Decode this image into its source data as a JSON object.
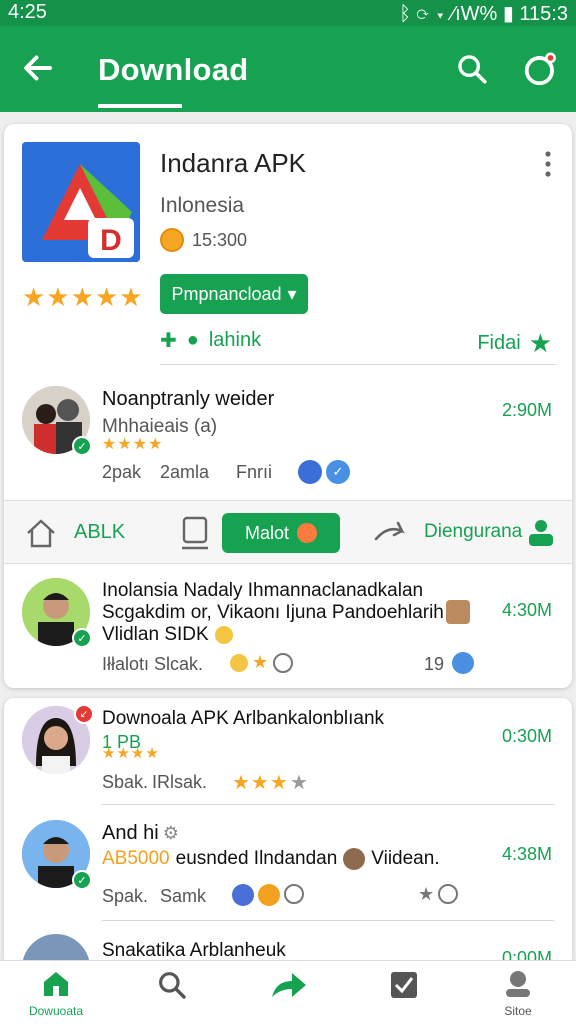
{
  "status_bar": {
    "time": "4:25",
    "right_text": "ᛒ ⟳ ▾ ⁄ıW% ▮ 115:3"
  },
  "app_bar": {
    "title": "Download"
  },
  "app": {
    "name": "Indanra APK",
    "region": "Inlonesia",
    "size": "15:300",
    "rating_stars": "★★★★★",
    "download_button": "Pmpnancload",
    "share_label": "lahink",
    "rate_label": "Fidai"
  },
  "row1": {
    "title": "Noanptranly weider",
    "subtitle": "Mhhaieais (a)",
    "stars": "★★★★",
    "meta_left": "2pak",
    "meta_mid": "2amla",
    "meta_right": "Fnrıi",
    "time": "2:90M"
  },
  "tabs": {
    "left": "ABLK",
    "pill": "Malot",
    "right": "Diengurana"
  },
  "row2": {
    "line1": "Inolansia Nadaly Ihmannaclanadkalan",
    "line2": "Scgakdim or, Vikaonı Ijuna Pandoehlarih",
    "line3": "Vlidlan SIDK",
    "meta_left": "Iłłalotı Slcak.",
    "count": "19",
    "time": "4:30M"
  },
  "row3": {
    "title": "Downoala APK Arlbankalonblıank",
    "small": "1 PB",
    "stars": "★★★★",
    "meta_left": "Sbak.",
    "meta_mid": "IRlsak.",
    "stars2": "★★★",
    "time": "0:30M"
  },
  "row4": {
    "title": "And hi",
    "highlight": "AB5000",
    "rest": "eusnded Ilndandan",
    "trail": "Viidean.",
    "meta_left": "Spak.",
    "meta_mid": "Samk",
    "time": "4:38M"
  },
  "row5": {
    "title": "Snakatika Arblanheuk",
    "time": "0:00M"
  },
  "bottom_nav": {
    "home": "Dowuoata",
    "profile": "Sitoe"
  },
  "colors": {
    "primary": "#17a252",
    "status_bar": "#14924a",
    "star": "#f6a623"
  }
}
